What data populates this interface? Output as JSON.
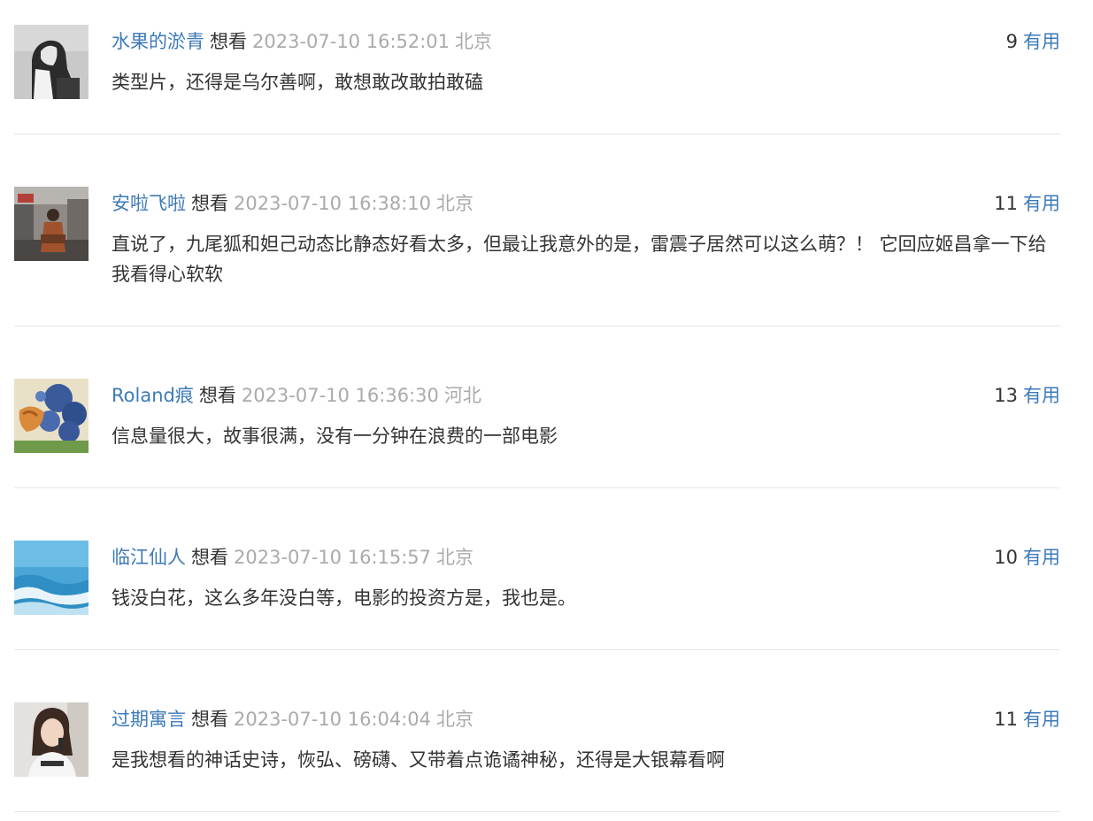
{
  "comments": [
    {
      "user": "水果的淤青",
      "rating": "想看",
      "time": "2023-07-10 16:52:01",
      "location": "北京",
      "votes": "9",
      "useful_label": "有用",
      "text": "类型片，还得是乌尔善啊，敢想敢改敢拍敢磕"
    },
    {
      "user": "安啦飞啦",
      "rating": "想看",
      "time": "2023-07-10 16:38:10",
      "location": "北京",
      "votes": "11",
      "useful_label": "有用",
      "text": "直说了，九尾狐和妲己动态比静态好看太多，但最让我意外的是，雷震子居然可以这么萌？！ 它回应姬昌拿一下给我看得心软软"
    },
    {
      "user": "Roland痕",
      "rating": "想看",
      "time": "2023-07-10 16:36:30",
      "location": "河北",
      "votes": "13",
      "useful_label": "有用",
      "text": "信息量很大，故事很满，没有一分钟在浪费的一部电影"
    },
    {
      "user": "临江仙人",
      "rating": "想看",
      "time": "2023-07-10 16:15:57",
      "location": "北京",
      "votes": "10",
      "useful_label": "有用",
      "text": "钱没白花，这么多年没白等，电影的投资方是，我也是。"
    },
    {
      "user": "过期寓言",
      "rating": "想看",
      "time": "2023-07-10 16:04:04",
      "location": "北京",
      "votes": "11",
      "useful_label": "有用",
      "text": "是我想看的神话史诗，恢弘、磅礴、又带着点诡谲神秘，还得是大银幕看啊"
    }
  ]
}
